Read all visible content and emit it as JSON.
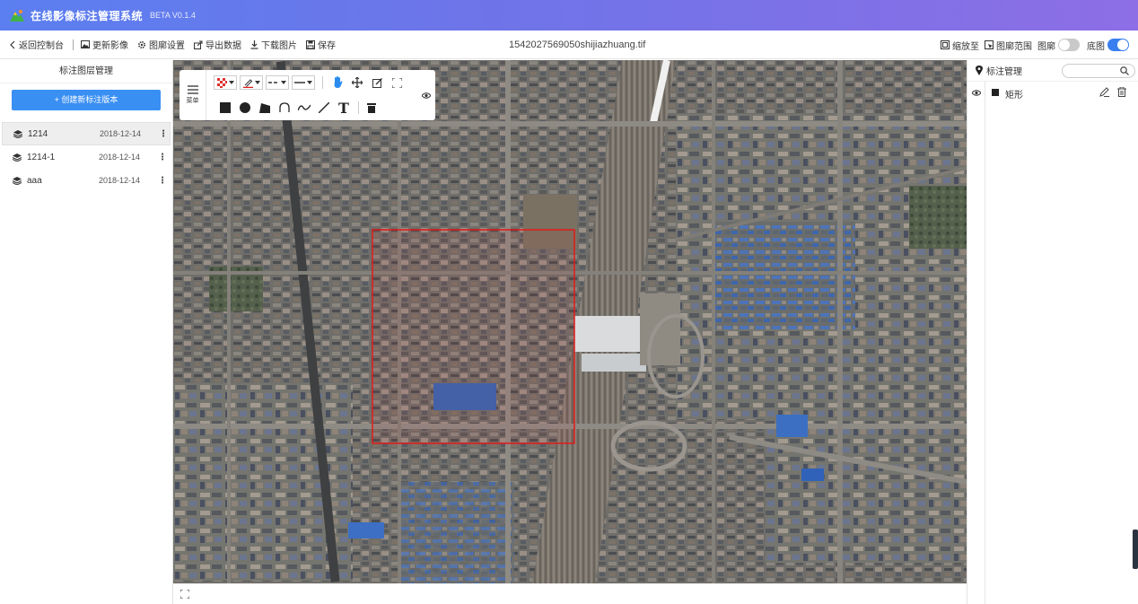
{
  "app": {
    "title": "在线影像标注管理系统",
    "version": "BETA V0.1.4",
    "logo_icon": "mountain-logo-icon"
  },
  "toolbar": {
    "back_label": "返回控制台",
    "update_image_label": "更新影像",
    "layer_settings_label": "图廓设置",
    "export_label": "导出数据",
    "download_label": "下载图片",
    "save_label": "保存",
    "file_name": "1542027569050shijiazhuang.tif",
    "zoom_to_label": "缩放至",
    "extent_label": "图廓范围",
    "frame_label": "图廓",
    "frame_toggle_on": false,
    "basemap_label": "底图",
    "basemap_toggle_on": true
  },
  "left_panel": {
    "title": "标注图层管理",
    "create_button": "+ 创建新标注版本",
    "layers": [
      {
        "name": "1214",
        "date": "2018-12-14",
        "more": "⋮",
        "selected": true
      },
      {
        "name": "1214-1",
        "date": "2018-12-14",
        "more": "⋮",
        "selected": false
      },
      {
        "name": "aaa",
        "date": "2018-12-14",
        "more": "⋮",
        "selected": false
      }
    ]
  },
  "draw_toolbar": {
    "menu_label": "菜单",
    "tools": [
      "fill-pattern-icon",
      "stroke-color-icon",
      "dash-style-icon",
      "line-width-icon",
      "pan-hand-icon",
      "move-icon",
      "edit-icon",
      "fullscreen-icon",
      "rectangle-icon",
      "circle-icon",
      "polygon-icon",
      "curve-icon",
      "freehand-icon",
      "line-icon",
      "text-icon",
      "delete-icon"
    ],
    "text_tool_glyph": "T"
  },
  "right_panel": {
    "title": "标注管理",
    "search_placeholder": "",
    "annotations": [
      {
        "name": "矩形",
        "visible": true
      }
    ]
  },
  "colors": {
    "accent": "#3a8ff3",
    "title_gradient_start": "#5b7ff0",
    "title_gradient_end": "#8d6ee6",
    "annotation_rect": "#e01a1a"
  }
}
